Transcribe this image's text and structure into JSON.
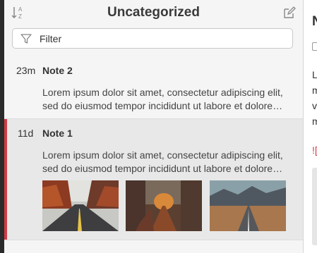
{
  "header": {
    "title": "Uncategorized"
  },
  "filter": {
    "placeholder": "Filter"
  },
  "notes": [
    {
      "age": "23m",
      "title": "Note 2",
      "excerpt": "Lorem ipsum dolor sit amet, consectetur adipiscing elit, sed do eiusmod tempor incididunt ut labore et dolore…",
      "selected": false
    },
    {
      "age": "11d",
      "title": "Note 1",
      "excerpt": "Lorem ipsum dolor sit amet, consectetur adipiscing elit, sed do eiusmod tempor incididunt ut labore et dolore…",
      "selected": true,
      "thumbnails": [
        "autumn-road",
        "forest-path",
        "mountain-road"
      ]
    }
  ],
  "editor": {
    "title": "N",
    "lines": [
      "L",
      "m",
      "v",
      "m"
    ],
    "link": "![",
    "accent_color": "#d13b45"
  },
  "icons": [
    "sort-alpha-icon",
    "compose-icon",
    "filter-funnel-icon"
  ],
  "colors": {
    "accent": "#d13b45",
    "sidebar_dark": "#2b2b2b",
    "list_bg": "#f5f5f5",
    "selected_bg": "#e8e8e8"
  }
}
